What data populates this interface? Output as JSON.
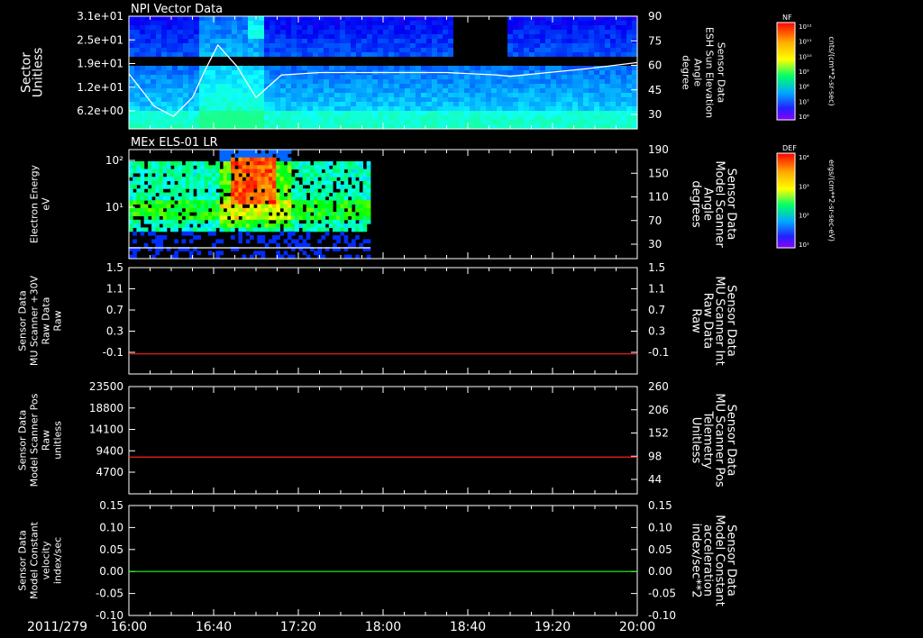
{
  "date_label": "2011/279",
  "time_ticks": [
    "16:00",
    "16:40",
    "17:20",
    "18:00",
    "18:40",
    "19:20",
    "20:00"
  ],
  "chart_data": [
    {
      "type": "heatmap",
      "title": "NPI Vector Data",
      "y_tick_labels": [
        "3.1e+01",
        "2.5e+01",
        "1.9e+01",
        "1.2e+01",
        "6.2e+00"
      ],
      "y_label_lines": [
        "Sector",
        "Unitless"
      ],
      "y2_tick_labels": [
        "90",
        "75",
        "60",
        "45",
        "30"
      ],
      "y2_label_lines": [
        "Sensor Data",
        "ESH Sun Elevation",
        "Angle",
        "degree"
      ],
      "colorbar": {
        "label": "NF",
        "units": "cnts/(cm**2-sr-sec)",
        "ticks": [
          "10¹²",
          "10¹¹",
          "10¹⁰",
          "10⁹",
          "10⁸",
          "10⁷",
          "10⁶"
        ]
      },
      "overlay_line": {
        "color": "#ffffff",
        "x_hours": [
          16.0,
          16.2,
          16.35,
          16.5,
          16.6,
          16.7,
          16.85,
          17.0,
          17.1,
          17.2,
          17.5,
          18.0,
          18.5,
          18.9,
          19.0,
          19.3,
          19.6,
          20.0
        ],
        "y_degrees": [
          59,
          33,
          25,
          40,
          62,
          82,
          65,
          40,
          49,
          58,
          60,
          60,
          60,
          58,
          57,
          60,
          63,
          68
        ]
      }
    },
    {
      "type": "heatmap",
      "title": "MEx ELS-01 LR",
      "y_tick_labels": [
        "10²",
        "10¹"
      ],
      "y_label_lines": [
        "Electron Energy",
        "eV"
      ],
      "y2_tick_labels": [
        "190",
        "150",
        "110",
        "70",
        "30"
      ],
      "y2_label_lines": [
        "Sensor Data",
        "Model Scanner",
        "Angle",
        "degrees"
      ],
      "colorbar": {
        "label": "DEF",
        "units": "ergs/(cm**2-sr-sec-eV)",
        "ticks": [
          "10⁴",
          "10³",
          "10²",
          "10¹"
        ]
      },
      "overlay_line": {
        "color": "#ffffff",
        "x_hours": [
          16.0,
          17.9
        ],
        "y_degrees": [
          7,
          7
        ]
      }
    },
    {
      "type": "line",
      "y_tick_labels": [
        "1.5",
        "1.1",
        "0.7",
        "0.3",
        "-0.1"
      ],
      "y_range": [
        -0.3,
        1.5
      ],
      "y_label_lines": [
        "Sensor Data",
        "MU Scanner +30V",
        "Raw Data",
        "Raw"
      ],
      "y2_tick_labels": [
        "1.5",
        "1.1",
        "0.7",
        "0.3",
        "-0.1"
      ],
      "y2_label_lines": [
        "Sensor Data",
        "MU Scanner Int",
        "Raw Data",
        "Raw"
      ],
      "series": [
        {
          "color": "#ff2020",
          "x_hours": [
            16.0,
            20.0
          ],
          "values": [
            0.04,
            0.04
          ]
        }
      ]
    },
    {
      "type": "line",
      "y_tick_labels": [
        "23500",
        "18800",
        "14100",
        "9400",
        "4700"
      ],
      "y_range": [
        0,
        23500
      ],
      "y_label_lines": [
        "Sensor Data",
        "Model Scanner Pos",
        "Raw",
        "unitless"
      ],
      "y2_tick_labels": [
        "260",
        "206",
        "152",
        "98",
        "44"
      ],
      "y2_label_lines": [
        "Sensor Data",
        "MU Scanner Pos",
        "Telemetry",
        "Unitless"
      ],
      "series": [
        {
          "color": "#ff2020",
          "x_hours": [
            16.0,
            20.0
          ],
          "values": [
            8050,
            8050
          ]
        }
      ]
    },
    {
      "type": "line",
      "y_tick_labels": [
        "0.15",
        "0.10",
        "0.05",
        "0.00",
        "-0.05",
        "-0.10"
      ],
      "y_range": [
        -0.1,
        0.15
      ],
      "y_label_lines": [
        "Sensor Data",
        "Model Constant",
        "velocity",
        "index/sec"
      ],
      "y2_tick_labels": [
        "0.15",
        "0.10",
        "0.05",
        "0.00",
        "-0.05",
        "-0.10"
      ],
      "y2_label_lines": [
        "Sensor Data",
        "Model Constant",
        "acceleration",
        "index/sec**2"
      ],
      "series": [
        {
          "color": "#20ff20",
          "x_hours": [
            16.0,
            20.0
          ],
          "values": [
            0.0,
            0.0
          ]
        }
      ]
    }
  ],
  "colors": {
    "axis": "#ffffff",
    "red_label": "#ff2020",
    "green_label": "#20ff20"
  }
}
